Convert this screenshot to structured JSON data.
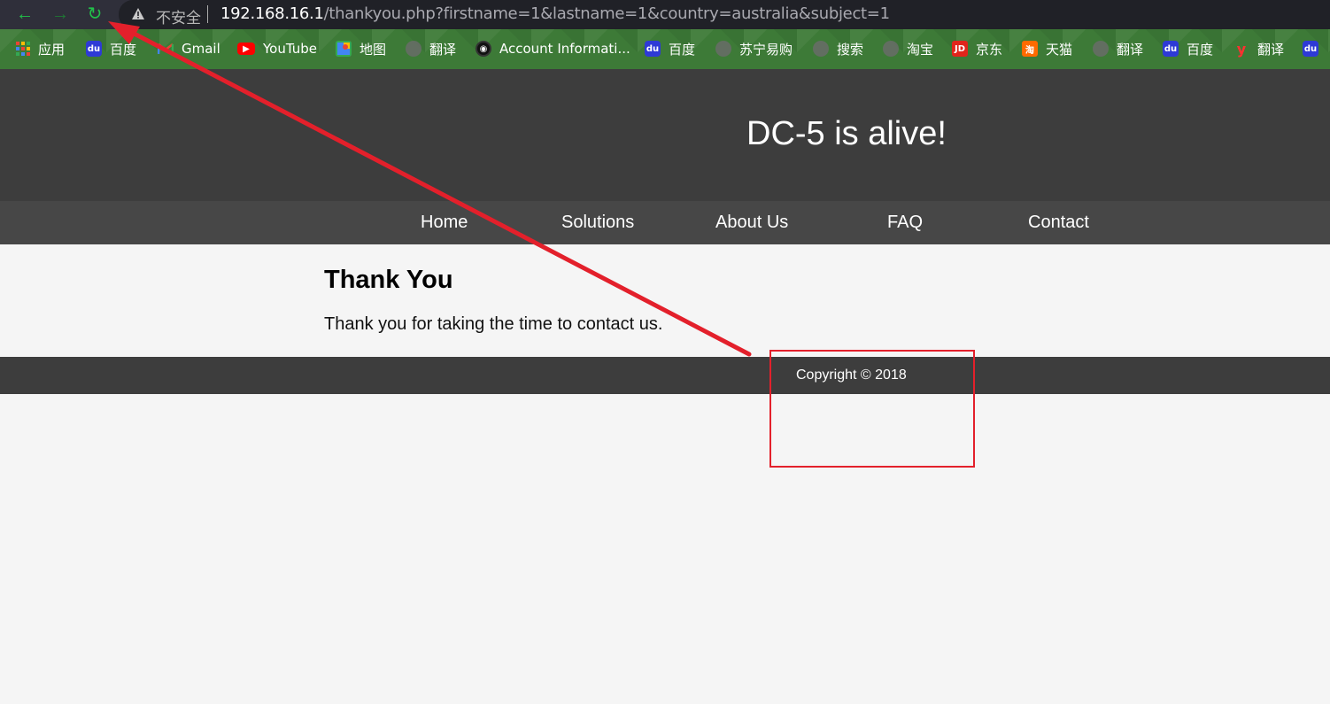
{
  "browser": {
    "insecure_label": "不安全",
    "url_host": "192.168.16.1",
    "url_path": "/thankyou.php?firstname=1&lastname=1&country=australia&subject=1",
    "nav_icons": [
      "back-arrow-icon",
      "forward-arrow-icon",
      "reload-icon"
    ]
  },
  "bookmarks": [
    {
      "label": "应用",
      "icon": "apps-grid-icon"
    },
    {
      "label": "百度",
      "icon": "baidu-icon"
    },
    {
      "label": "Gmail",
      "icon": "gmail-icon"
    },
    {
      "label": "YouTube",
      "icon": "youtube-icon"
    },
    {
      "label": "地图",
      "icon": "maps-icon"
    },
    {
      "label": "翻译",
      "icon": "globe-icon"
    },
    {
      "label": "Account Informati...",
      "icon": "account-icon"
    },
    {
      "label": "百度",
      "icon": "baidu-icon"
    },
    {
      "label": "苏宁易购",
      "icon": "globe-icon"
    },
    {
      "label": "搜索",
      "icon": "globe-icon"
    },
    {
      "label": "淘宝",
      "icon": "globe-icon"
    },
    {
      "label": "京东",
      "icon": "jd-icon"
    },
    {
      "label": "天猫",
      "icon": "taobao-icon"
    },
    {
      "label": "翻译",
      "icon": "globe-icon"
    },
    {
      "label": "百度",
      "icon": "baidu-icon"
    },
    {
      "label": "翻译",
      "icon": "youdao-icon"
    }
  ],
  "page": {
    "site_title": "DC-5 is alive!",
    "nav": [
      "Home",
      "Solutions",
      "About Us",
      "FAQ",
      "Contact"
    ],
    "heading": "Thank You",
    "body": "Thank you for taking the time to contact us.",
    "footer": "Copyright © 2018"
  },
  "colors": {
    "header_bg": "#3d3d3d",
    "nav_bg": "#474747",
    "page_bg": "#f5f5f5",
    "annotation_red": "#e3202b",
    "chrome_green": "#22c04a"
  }
}
